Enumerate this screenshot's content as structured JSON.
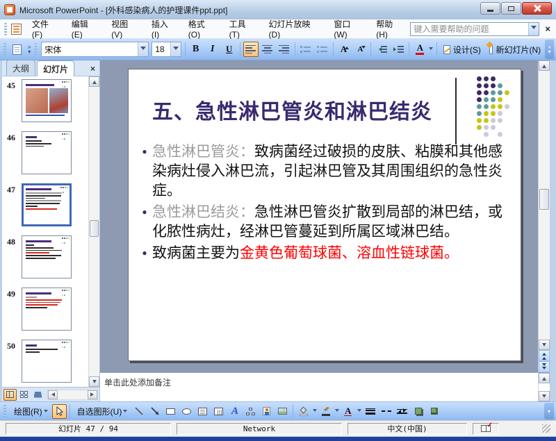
{
  "window": {
    "title": "Microsoft PowerPoint - [外科感染病人的护理课件ppt.ppt]"
  },
  "glyphs": {
    "overflow": "»",
    "dropdown": "▾",
    "close": "×",
    "check": "✓"
  },
  "menu_bar": {
    "items": [
      "文件(F)",
      "编辑(E)",
      "视图(V)",
      "插入(I)",
      "格式(O)",
      "工具(T)",
      "幻灯片放映(D)",
      "窗口(W)",
      "帮助(H)"
    ],
    "help_box_placeholder": "键入需要帮助的问题"
  },
  "format_toolbar": {
    "font_name": "宋体",
    "font_size": "18",
    "bold": "B",
    "italic": "I",
    "underline": "U",
    "grow_font": "A",
    "shrink_font": "A",
    "font_color": "A",
    "design_label": "设计(S)",
    "new_slide_label": "新幻灯片(N)"
  },
  "slides_pane": {
    "tab_outline": "大纲",
    "tab_slides": "幻灯片",
    "thumbnails": [
      {
        "number": "45",
        "selected": false,
        "photo": true,
        "title_w": 68,
        "lines": []
      },
      {
        "number": "46",
        "selected": false,
        "photo": false,
        "title_w": 26,
        "lines": [
          [
            "k",
            38
          ],
          [
            "k",
            60
          ],
          [
            "k",
            42
          ]
        ]
      },
      {
        "number": "47",
        "selected": true,
        "photo": false,
        "title_w": 60,
        "lines": [
          [
            "g",
            86
          ],
          [
            "k",
            84
          ],
          [
            "k",
            46
          ],
          [
            "g",
            84
          ],
          [
            "k",
            80
          ],
          [
            "k",
            28
          ],
          [
            "r",
            74
          ]
        ]
      },
      {
        "number": "48",
        "selected": false,
        "photo": false,
        "title_w": 60,
        "lines": [
          [
            "k",
            20
          ],
          [
            "k",
            66
          ],
          [
            "k",
            86
          ],
          [
            "r",
            56
          ],
          [
            "k",
            84
          ],
          [
            "k",
            70
          ]
        ]
      },
      {
        "number": "49",
        "selected": false,
        "photo": false,
        "title_w": 60,
        "lines": [
          [
            "g",
            26
          ],
          [
            "r",
            86
          ],
          [
            "r",
            82
          ],
          [
            "r",
            76
          ],
          [
            "k",
            50
          ]
        ]
      },
      {
        "number": "50",
        "selected": false,
        "photo": false,
        "title_w": 26,
        "lines": [
          [
            "k",
            76
          ],
          [
            "k",
            32
          ]
        ]
      }
    ]
  },
  "slide": {
    "title": "五、急性淋巴管炎和淋巴结炎",
    "bullet_char": "●",
    "bullets": [
      {
        "label": "急性淋巴管炎：",
        "text": "致病菌经过破损的皮肤、粘膜和其他感染病灶侵入淋巴流，引起淋巴管及其周围组织的急性炎症。",
        "red": ""
      },
      {
        "label": "急性淋巴结炎：",
        "text": "急性淋巴管炎扩散到局部的淋巴结，或化脓性病灶，经淋巴管蔓延到所属区域淋巴结。",
        "red": ""
      },
      {
        "label": "",
        "text": "致病菌主要为",
        "red": "金黄色葡萄球菌、溶血性链球菌。"
      }
    ],
    "logo_dots": {
      "pattern": [
        "ppp..",
        "pppt.",
        "pptty",
        "ptty.",
        "ttyyl",
        "tyyl.",
        "yyll.",
        "yll..",
        ".l.l."
      ],
      "colors": {
        "p": "#3d2b5e",
        "t": "#5b9b9b",
        "y": "#c3c614",
        "l": "#c9cade"
      }
    },
    "colors": {
      "title": "#3a2a70",
      "label": "#9b9b9b",
      "body": "#111111",
      "red": "#ff0000"
    }
  },
  "notes": {
    "placeholder": "单击此处添加备注"
  },
  "drawing_toolbar": {
    "draw_label": "绘图(R)",
    "autoshapes_label": "自选图形(U)",
    "wordart": "A",
    "font_color": "A"
  },
  "status_bar": {
    "slide_indicator": "幻灯片 47 / 94",
    "network": "Network",
    "language": "中文(中国)"
  }
}
